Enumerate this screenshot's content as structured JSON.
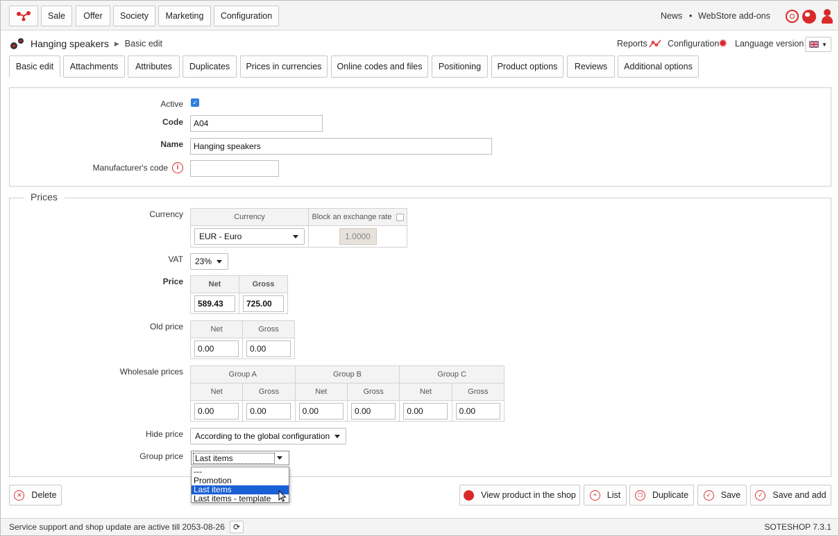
{
  "topnav": {
    "items": [
      "Sale",
      "Offer",
      "Society",
      "Marketing",
      "Configuration"
    ],
    "news": "News",
    "separator": "•",
    "addons": "WebStore add-ons"
  },
  "header": {
    "title": "Hanging speakers",
    "breadcrumb": "Basic edit",
    "reports": "Reports",
    "configuration": "Configuration",
    "language_label": "Language version"
  },
  "tabs": [
    "Basic edit",
    "Attachments",
    "Attributes",
    "Duplicates",
    "Prices in currencies",
    "Online codes and files",
    "Positioning",
    "Product options",
    "Reviews",
    "Additional options"
  ],
  "basic": {
    "active_label": "Active",
    "active_checked": true,
    "code_label": "Code",
    "code_value": "A04",
    "name_label": "Name",
    "name_value": "Hanging speakers",
    "manufacturer_label": "Manufacturer's code",
    "manufacturer_value": ""
  },
  "prices": {
    "legend": "Prices",
    "currency_label": "Currency",
    "currency_col": "Currency",
    "block_col": "Block an exchange rate",
    "currency_value": "EUR - Euro",
    "exchange_rate": "1.0000",
    "vat_label": "VAT",
    "vat_value": "23%",
    "price_label": "Price",
    "net": "Net",
    "gross": "Gross",
    "price_net": "589.43",
    "price_gross": "725.00",
    "old_label": "Old price",
    "old_net": "0.00",
    "old_gross": "0.00",
    "wholesale_label": "Wholesale prices",
    "groups": [
      {
        "name": "Group A",
        "net": "0.00",
        "gross": "0.00"
      },
      {
        "name": "Group B",
        "net": "0.00",
        "gross": "0.00"
      },
      {
        "name": "Group C",
        "net": "0.00",
        "gross": "0.00"
      }
    ],
    "hide_label": "Hide price",
    "hide_value": "According to the global configuration",
    "group_price_label": "Group price",
    "group_price_value": "Last items",
    "group_price_options": [
      "---",
      "Promotion",
      "Last items",
      "Last items - template"
    ],
    "group_price_selected_index": 2
  },
  "actions": {
    "delete": "Delete",
    "view": "View product in the shop",
    "list": "List",
    "duplicate": "Duplicate",
    "save": "Save",
    "save_add": "Save and add"
  },
  "status": {
    "text": "Service support and shop update are active till 2053-08-26",
    "version": "SOTESHOP 7.3.1"
  },
  "colors": {
    "accent": "#d92a2a",
    "selection": "#1a5fd6",
    "checkbox": "#2f7de1"
  }
}
